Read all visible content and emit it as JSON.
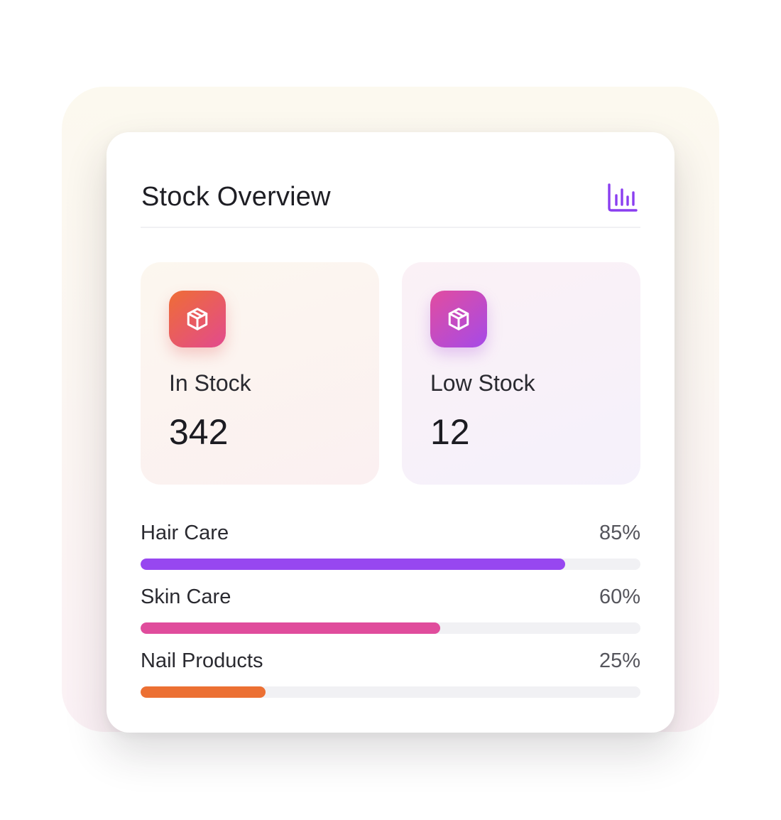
{
  "card": {
    "title": "Stock Overview",
    "chart_icon": "bar-chart-icon"
  },
  "stats": {
    "in_stock": {
      "label": "In Stock",
      "value": "342",
      "icon": "package-icon"
    },
    "low_stock": {
      "label": "Low Stock",
      "value": "12",
      "icon": "package-icon"
    }
  },
  "categories": [
    {
      "label": "Hair Care",
      "percent_text": "85%",
      "fraction": 0.85,
      "color": "#9747f0"
    },
    {
      "label": "Skin Care",
      "percent_text": "60%",
      "fraction": 0.6,
      "color": "#e04c9c"
    },
    {
      "label": "Nail Products",
      "percent_text": "25%",
      "fraction": 0.25,
      "color": "#ec7033"
    }
  ],
  "colors": {
    "accent_purple": "#8a3ef0",
    "track": "#f1f1f4"
  }
}
